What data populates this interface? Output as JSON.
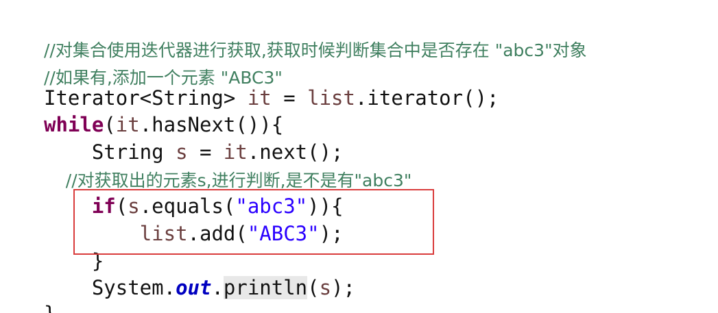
{
  "editor": {
    "top_fragment": "",
    "lines": [
      {
        "name": "line-1",
        "tokens": [
          {
            "text": "//对集合使用迭代器进行获取,获取时候判断集合中是否存在 \"abc3\"对象",
            "class": "comment"
          }
        ]
      },
      {
        "name": "line-2",
        "tokens": [
          {
            "text": "//如果有,添加一个元素 \"ABC3\"",
            "class": "comment"
          }
        ]
      },
      {
        "name": "line-3",
        "tokens": [
          {
            "text": "Iterator<String> ",
            "class": ""
          },
          {
            "text": "it",
            "class": "local"
          },
          {
            "text": " = ",
            "class": ""
          },
          {
            "text": "list",
            "class": "local"
          },
          {
            "text": ".iterator();",
            "class": ""
          }
        ]
      },
      {
        "name": "line-4",
        "tokens": [
          {
            "text": "while",
            "class": "kw"
          },
          {
            "text": "(",
            "class": ""
          },
          {
            "text": "it",
            "class": "local"
          },
          {
            "text": ".hasNext()){",
            "class": ""
          }
        ]
      },
      {
        "name": "line-5",
        "tokens": [
          {
            "text": "    String ",
            "class": ""
          },
          {
            "text": "s",
            "class": "local"
          },
          {
            "text": " = ",
            "class": ""
          },
          {
            "text": "it",
            "class": "local"
          },
          {
            "text": ".next();",
            "class": ""
          }
        ]
      },
      {
        "name": "line-6",
        "tokens": [
          {
            "text": "    //对获取出的元素s,进行判断,是不是有\"abc3\"",
            "class": "comment"
          }
        ]
      },
      {
        "name": "line-7",
        "tokens": [
          {
            "text": "    ",
            "class": ""
          },
          {
            "text": "if",
            "class": "kw"
          },
          {
            "text": "(",
            "class": ""
          },
          {
            "text": "s",
            "class": "local"
          },
          {
            "text": ".equals(",
            "class": ""
          },
          {
            "text": "\"abc3\"",
            "class": "str"
          },
          {
            "text": ")){",
            "class": ""
          }
        ]
      },
      {
        "name": "line-8",
        "tokens": [
          {
            "text": "        ",
            "class": ""
          },
          {
            "text": "list",
            "class": "local"
          },
          {
            "text": ".add(",
            "class": ""
          },
          {
            "text": "\"ABC3\"",
            "class": "str"
          },
          {
            "text": ");",
            "class": ""
          }
        ]
      },
      {
        "name": "line-9",
        "tokens": [
          {
            "text": "    }",
            "class": ""
          }
        ]
      },
      {
        "name": "line-10",
        "tokens": [
          {
            "text": "    System.",
            "class": ""
          },
          {
            "text": "out",
            "class": "field"
          },
          {
            "text": ".",
            "class": ""
          },
          {
            "text": "println",
            "class": "hl"
          },
          {
            "text": "(",
            "class": ""
          },
          {
            "text": "s",
            "class": "local"
          },
          {
            "text": ");",
            "class": ""
          }
        ]
      },
      {
        "name": "line-11",
        "tokens": [
          {
            "text": "}",
            "class": ""
          }
        ]
      }
    ]
  },
  "colors": {
    "background": "#ffffff",
    "comment": "#3f7f5f",
    "keyword": "#7f0055",
    "string": "#2a00ff",
    "local_variable": "#6a3e3e",
    "field": "#0000c0",
    "highlight_box": "#d93b3b"
  }
}
